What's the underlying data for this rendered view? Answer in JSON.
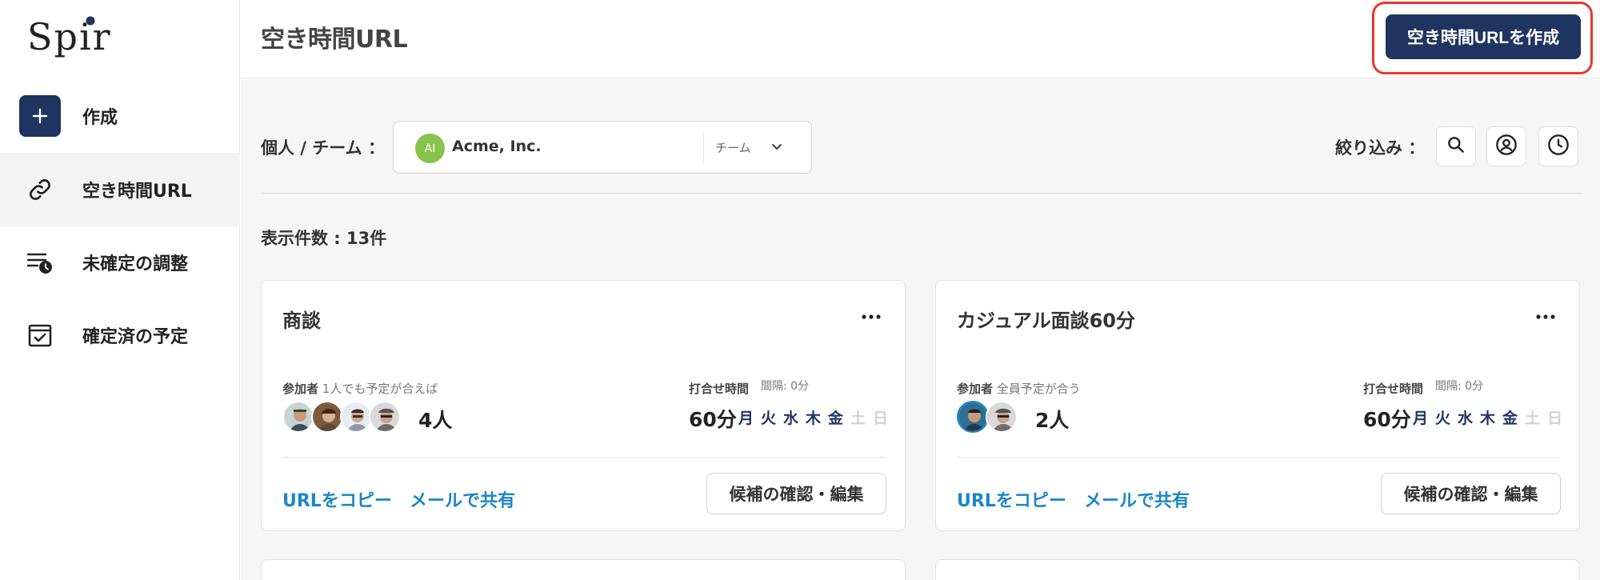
{
  "app": {
    "logo_text": "Spir"
  },
  "sidebar": {
    "items": [
      {
        "label": "作成",
        "icon": "plus-icon"
      },
      {
        "label": "空き時間URL",
        "icon": "link-icon",
        "active": true
      },
      {
        "label": "未確定の調整",
        "icon": "pending-list-icon"
      },
      {
        "label": "確定済の予定",
        "icon": "checked-calendar-icon"
      }
    ]
  },
  "header": {
    "title": "空き時間URL",
    "create_button": "空き時間URLを作成"
  },
  "filter": {
    "label": "個人 / チーム ：",
    "selected": {
      "initials": "AI",
      "name": "Acme, Inc.",
      "type": "チーム"
    },
    "refine_label": "絞り込み ："
  },
  "result_count": "表示件数 : 13件",
  "cards": [
    {
      "title": "商談",
      "participants_label": "参加者",
      "participants_note": "1人でも予定が合えば",
      "participant_count": "4人",
      "meeting_label": "打合せ時間",
      "gap_label": "間隔: 0分",
      "duration": "60分",
      "days": [
        {
          "label": "月",
          "on": true
        },
        {
          "label": "火",
          "on": true
        },
        {
          "label": "水",
          "on": true
        },
        {
          "label": "木",
          "on": true
        },
        {
          "label": "金",
          "on": true
        },
        {
          "label": "土",
          "on": false
        },
        {
          "label": "日",
          "on": false
        }
      ],
      "copy_url": "URLをコピー",
      "share_mail": "メールで共有",
      "edit": "候補の確認・編集"
    },
    {
      "title": "カジュアル面談60分",
      "participants_label": "参加者",
      "participants_note": "全員予定が合う",
      "participant_count": "2人",
      "meeting_label": "打合せ時間",
      "gap_label": "間隔: 0分",
      "duration": "60分",
      "days": [
        {
          "label": "月",
          "on": true
        },
        {
          "label": "火",
          "on": true
        },
        {
          "label": "水",
          "on": true
        },
        {
          "label": "木",
          "on": true
        },
        {
          "label": "金",
          "on": true
        },
        {
          "label": "土",
          "on": false
        },
        {
          "label": "日",
          "on": false
        }
      ],
      "copy_url": "URLをコピー",
      "share_mail": "メールで共有",
      "edit": "候補の確認・編集"
    }
  ],
  "colors": {
    "primary": "#1f3461",
    "link": "#1a86c8",
    "highlight": "#e8382e",
    "team_avatar": "#86c34a",
    "day_on": "#1f3461",
    "day_off": "#cfd3da"
  }
}
